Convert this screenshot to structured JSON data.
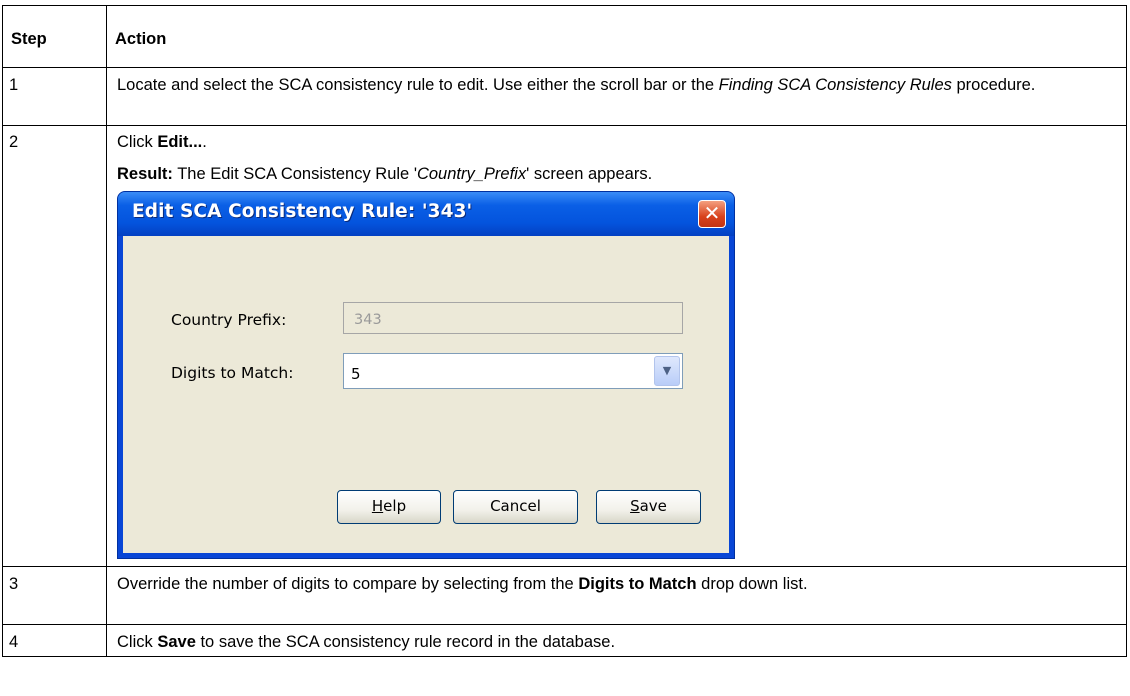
{
  "table": {
    "headers": {
      "step": "Step",
      "action": "Action"
    },
    "rows": [
      {
        "step": "1",
        "parts": {
          "a": "Locate and select the SCA consistency rule to edit. Use either the scroll bar or the ",
          "b": "Finding SCA Consistency Rules",
          "c": " procedure."
        }
      },
      {
        "step": "2",
        "click_prefix": "Click ",
        "click_target": "Edit...",
        "click_suffix": ".",
        "result_label": "Result:",
        "result_a": " The Edit SCA Consistency Rule '",
        "result_b": "Country_Prefix",
        "result_c": "' screen appears."
      },
      {
        "step": "3",
        "parts": {
          "a": "Override the number of digits to compare by selecting from the ",
          "b": "Digits to Match",
          "c": " drop down list."
        }
      },
      {
        "step": "4",
        "parts": {
          "a": "Click ",
          "b": "Save",
          "c": " to save the SCA consistency rule record in the database."
        }
      }
    ]
  },
  "dialog": {
    "title": "Edit SCA Consistency Rule: '343'",
    "close_glyph": "✕",
    "country_prefix_label": "Country Prefix:",
    "country_prefix_value": "343",
    "digits_label": "Digits to Match:",
    "digits_value": "5",
    "dropdown_icon": "chevron-down-icon",
    "buttons": {
      "help_mnemonic": "H",
      "help_rest": "elp",
      "cancel": "Cancel",
      "save_mnemonic": "S",
      "save_rest": "ave"
    }
  }
}
